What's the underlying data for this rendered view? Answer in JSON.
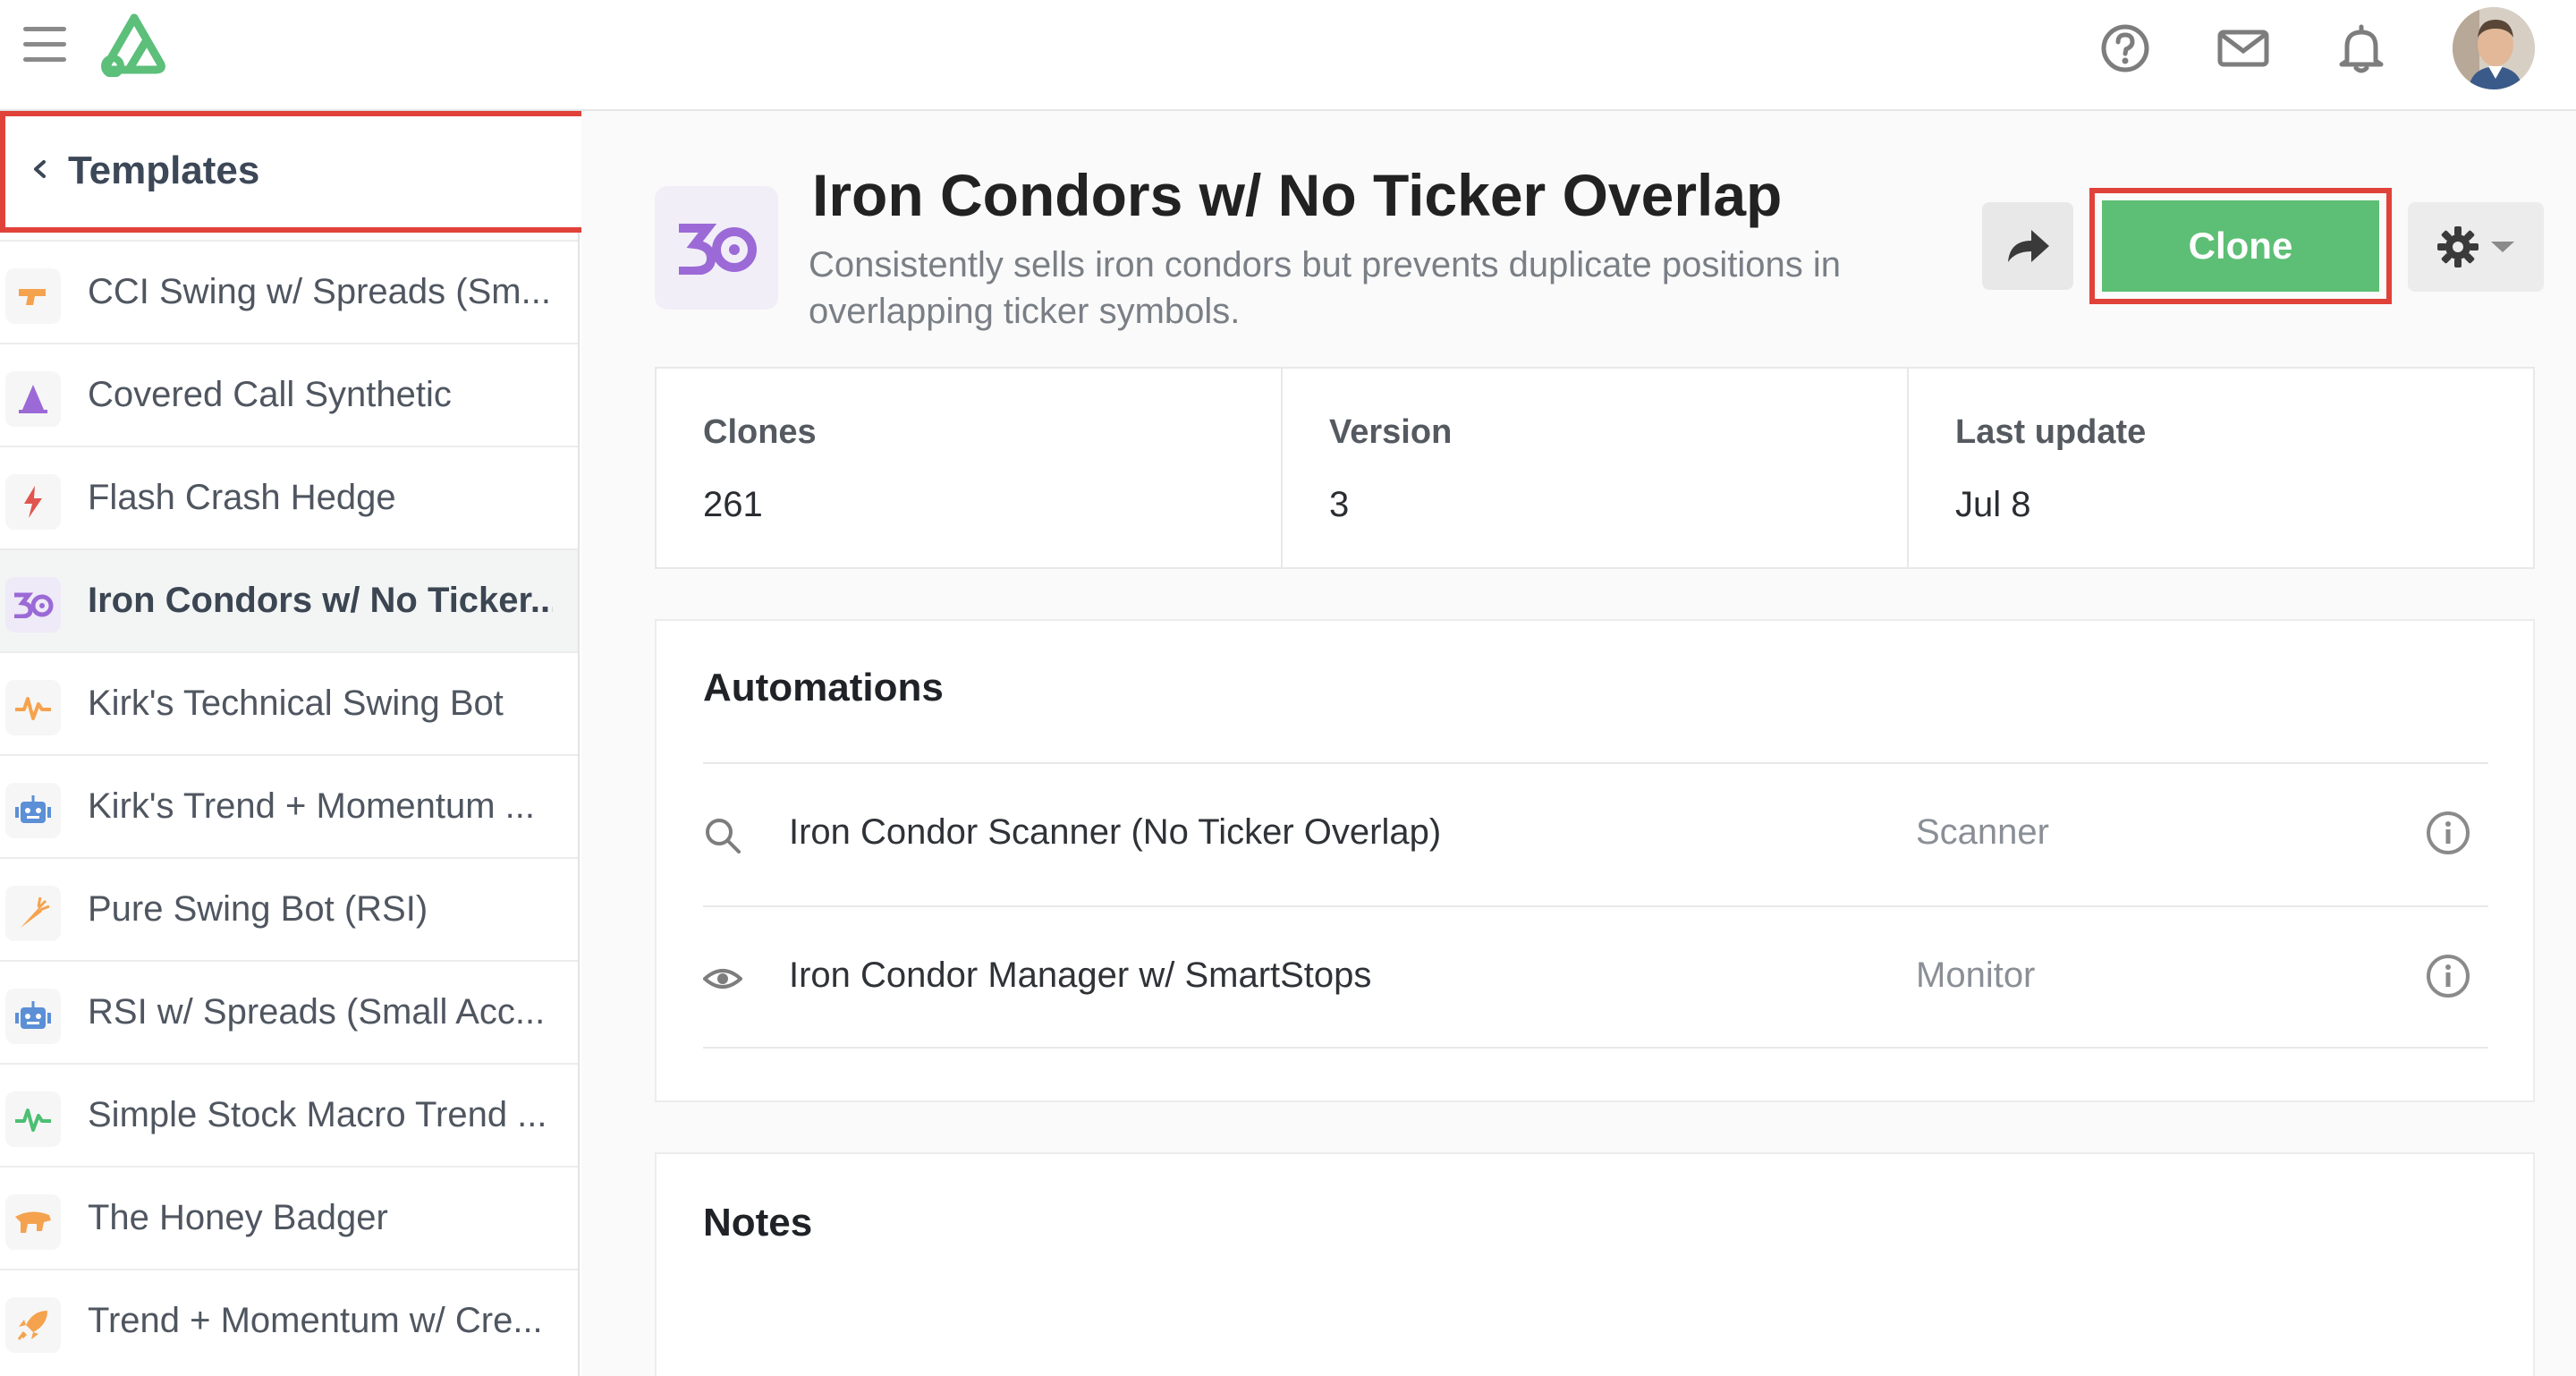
{
  "topbar": {
    "icons": [
      "menu-icon",
      "logo",
      "help-icon",
      "mail-icon",
      "bell-icon",
      "avatar"
    ]
  },
  "sidebar": {
    "header_label": "Templates",
    "items": [
      {
        "label": "CCI Swing w/ Spreads (Sm...",
        "icon": "gun-icon",
        "color": "#f5a24e"
      },
      {
        "label": "Covered Call Synthetic",
        "icon": "wizard-hat-icon",
        "color": "#9b6ad6"
      },
      {
        "label": "Flash Crash Hedge",
        "icon": "lightning-icon",
        "color": "#e0554d"
      },
      {
        "label": "Iron Condors w/ No Ticker...",
        "icon": "iron-condor-icon",
        "color": "#9b6ad6",
        "active": true
      },
      {
        "label": "Kirk's Technical Swing Bot",
        "icon": "pulse-icon",
        "color": "#f5a24e"
      },
      {
        "label": "Kirk's Trend + Momentum ...",
        "icon": "robot-icon",
        "color": "#5b8fd6"
      },
      {
        "label": "Pure Swing Bot (RSI)",
        "icon": "carrot-icon",
        "color": "#f5a24e"
      },
      {
        "label": "RSI w/ Spreads (Small Acc...",
        "icon": "robot-icon",
        "color": "#5b8fd6"
      },
      {
        "label": "Simple Stock Macro Trend ...",
        "icon": "pulse-icon",
        "color": "#4cbf72"
      },
      {
        "label": "The Honey Badger",
        "icon": "badger-icon",
        "color": "#f5a24e"
      },
      {
        "label": "Trend + Momentum w/ Cre...",
        "icon": "rocket-icon",
        "color": "#f5a24e"
      }
    ]
  },
  "bot": {
    "title": "Iron Condors w/ No Ticker Overlap",
    "description": "Consistently sells iron condors but prevents duplicate positions in overlapping ticker symbols.",
    "clone_label": "Clone",
    "accent": "#9b6ad6",
    "clone_color": "#5dbf75"
  },
  "stats": [
    {
      "label": "Clones",
      "value": "261"
    },
    {
      "label": "Version",
      "value": "3"
    },
    {
      "label": "Last update",
      "value": "Jul 8"
    }
  ],
  "automations": {
    "title": "Automations",
    "rows": [
      {
        "icon": "search-icon",
        "name": "Iron Condor Scanner (No Ticker Overlap)",
        "type": "Scanner"
      },
      {
        "icon": "eye-icon",
        "name": "Iron Condor Manager w/ SmartStops",
        "type": "Monitor"
      }
    ]
  },
  "notes": {
    "title": "Notes"
  }
}
